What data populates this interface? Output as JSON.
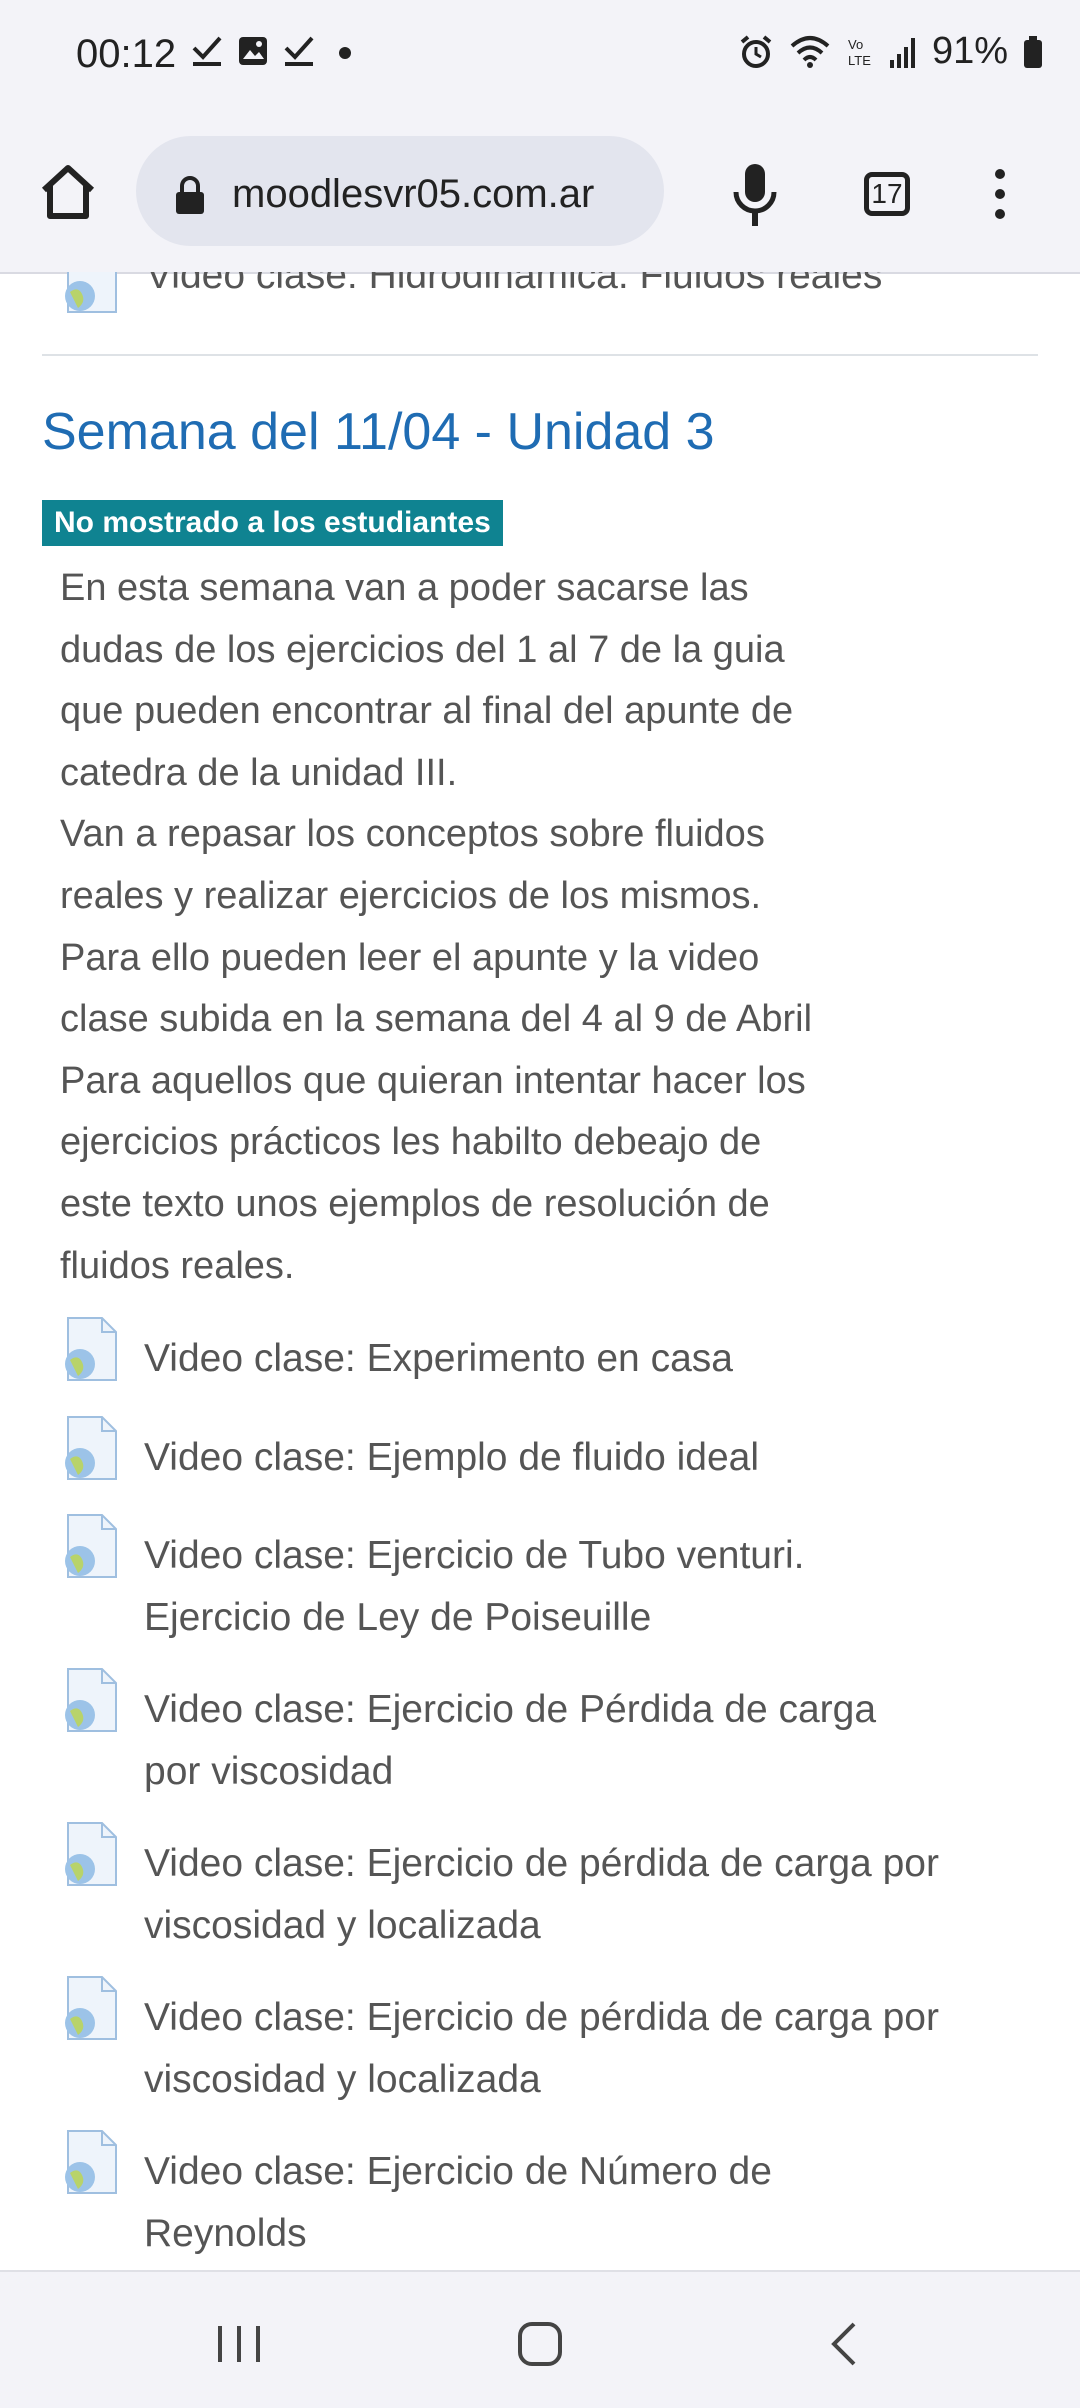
{
  "status_bar": {
    "time": "00:12",
    "battery": "91%",
    "icons_left": [
      "check-icon",
      "image-icon",
      "check-icon",
      "dot-icon"
    ],
    "icons_right": [
      "alarm-icon",
      "wifi-icon",
      "volte-icon",
      "signal-icon",
      "battery-icon"
    ]
  },
  "browser": {
    "url": "moodlesvr05.com.ar",
    "tab_count": "17"
  },
  "content": {
    "previous_item_label": "Video clase: Hidrodinámica. Fluidos reales",
    "section": {
      "title": "Semana del 11/04 - Unidad 3",
      "badge": "No mostrado a los estudiantes",
      "summary_lines": [
        "En esta semana van a poder sacarse las",
        "dudas de los ejercicios del 1 al 7 de la guia",
        "que pueden encontrar al final del apunte de",
        "catedra de la unidad III.",
        "Van a repasar los conceptos sobre fluidos",
        "reales y realizar ejercicios de los mismos.",
        "Para ello pueden leer el apunte y la video",
        "clase subida en la semana del 4 al 9 de Abril",
        "Para aquellos que quieran intentar hacer los",
        "ejercicios prácticos les habilto debeajo de",
        "este texto unos ejemplos de resolución de",
        "fluidos reales."
      ],
      "activities": [
        {
          "line1": "Video clase: Experimento en casa",
          "line2": ""
        },
        {
          "line1": "Video clase: Ejemplo de fluido ideal",
          "line2": ""
        },
        {
          "line1": "Video clase: Ejercicio de Tubo venturi.",
          "line2": "Ejercicio de Ley de Poiseuille"
        },
        {
          "line1": "Video clase: Ejercicio de Pérdida de carga",
          "line2": "por viscosidad"
        },
        {
          "line1": "Video clase: Ejercicio de pérdida de carga por",
          "line2": "viscosidad y localizada"
        },
        {
          "line1": "Video clase: Ejercicio de pérdida de carga por",
          "line2": "viscosidad y localizada"
        },
        {
          "line1": "Video clase: Ejercicio de Número de",
          "line2": "Reynolds"
        }
      ]
    }
  },
  "colors": {
    "section_title": "#1f6cb3",
    "badge_bg": "#0f8391",
    "text": "#555555",
    "chrome_bg": "#f3f3f8"
  }
}
